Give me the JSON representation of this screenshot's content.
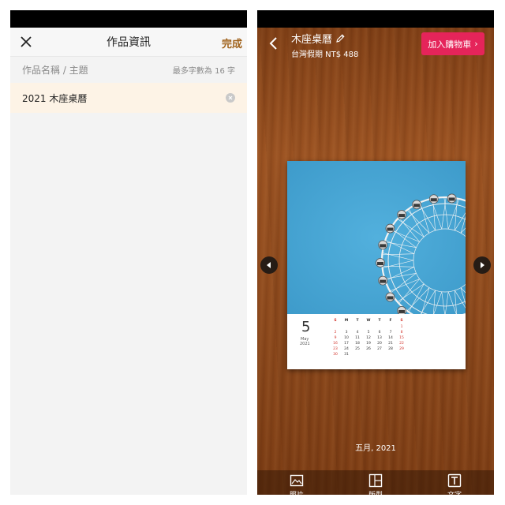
{
  "left": {
    "header": {
      "title": "作品資訊",
      "done_label": "完成"
    },
    "field": {
      "label": "作品名稱 / 主題",
      "limit_hint": "最多字數為 16 字",
      "value": "2021 木座桌曆"
    }
  },
  "right": {
    "header": {
      "title": "木座桌曆",
      "subtitle": "台灣假期 NT$ 488",
      "cart_label": "加入購物車",
      "cart_chevron": "›"
    },
    "calendar": {
      "month_number": "5",
      "month_name": "May",
      "year": "2021",
      "weekdays": [
        "S",
        "M",
        "T",
        "W",
        "T",
        "F",
        "S"
      ],
      "weeks": [
        [
          "",
          "",
          "",
          "",
          "",
          "",
          "1"
        ],
        [
          "2",
          "3",
          "4",
          "5",
          "6",
          "7",
          "8"
        ],
        [
          "9",
          "10",
          "11",
          "12",
          "13",
          "14",
          "15"
        ],
        [
          "16",
          "17",
          "18",
          "19",
          "20",
          "21",
          "22"
        ],
        [
          "23",
          "24",
          "25",
          "26",
          "27",
          "28",
          "29"
        ],
        [
          "30",
          "31",
          "",
          "",
          "",
          "",
          ""
        ]
      ]
    },
    "page_caption": "五月, 2021",
    "toolbar": {
      "items": [
        {
          "label": "照片",
          "icon": "photo-icon"
        },
        {
          "label": "版型",
          "icon": "layout-icon"
        },
        {
          "label": "文字",
          "icon": "text-icon"
        }
      ]
    },
    "colors": {
      "accent_done": "#a0621b",
      "cart_button": "#e5245a",
      "holiday_red": "#d2342c",
      "input_highlight": "#fdf3e6"
    }
  }
}
